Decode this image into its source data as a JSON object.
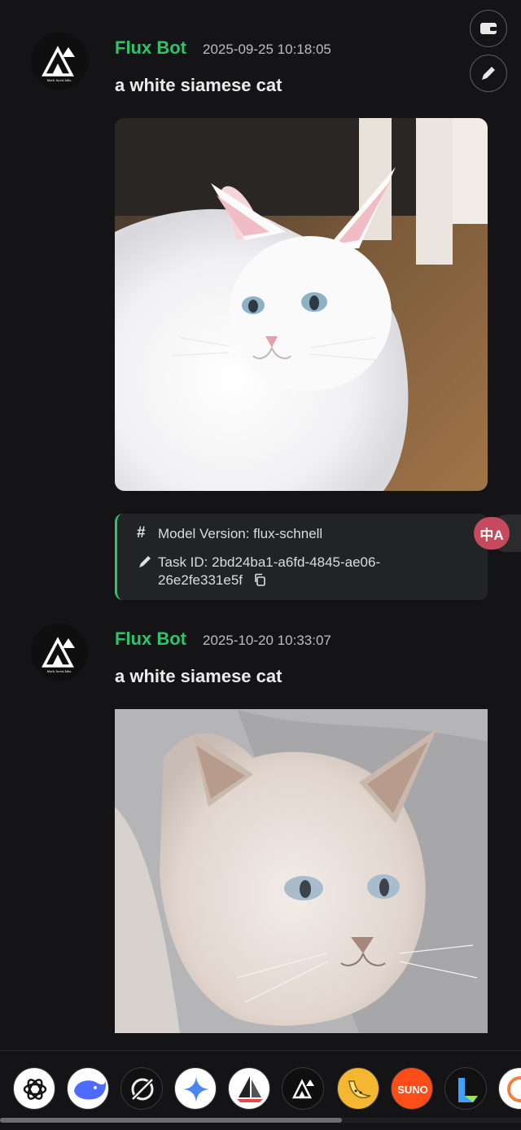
{
  "messages": [
    {
      "bot_name": "Flux Bot",
      "timestamp": "2025-09-25 10:18:05",
      "prompt": "a white siamese cat",
      "avatar_text": "black forest labs.",
      "info": {
        "model_version": "Model Version: flux-schnell",
        "task_id_line1": "Task ID: 2bd24ba1-a6fd-4845-ae06-",
        "task_id_line2": "26e2fe331e5f"
      }
    },
    {
      "bot_name": "Flux Bot",
      "timestamp": "2025-10-20 10:33:07",
      "prompt": "a white siamese cat",
      "avatar_text": "black forest labs."
    }
  ],
  "floating": {
    "translate_label": "中A"
  },
  "model_bar": {
    "items": [
      {
        "name": "openai",
        "icon": "openai-icon",
        "color": "#ffffff"
      },
      {
        "name": "deepseek",
        "icon": "whale-icon",
        "color": "#4d6bfe"
      },
      {
        "name": "grok",
        "icon": "grok-icon",
        "color": "#111111"
      },
      {
        "name": "gemini",
        "icon": "gemini-sparkle-icon",
        "color": "#ffffff"
      },
      {
        "name": "midjourney",
        "icon": "sailboat-icon",
        "color": "#ffffff"
      },
      {
        "name": "flux",
        "icon": "bfl-icon",
        "color": "#0f0f10"
      },
      {
        "name": "banana",
        "icon": "banana-icon",
        "color": "#f5b731"
      },
      {
        "name": "suno",
        "label": "SUNO",
        "icon": "suno-icon",
        "color": "#ff4d1a"
      },
      {
        "name": "kling",
        "icon": "kling-icon",
        "color": "#111111"
      },
      {
        "name": "partial",
        "icon": "partial-icon",
        "color": "#ffffff"
      }
    ]
  },
  "colors": {
    "accent": "#2ec46b",
    "background": "#141416",
    "info_box": "#222325",
    "translate": "#c64a5e"
  }
}
